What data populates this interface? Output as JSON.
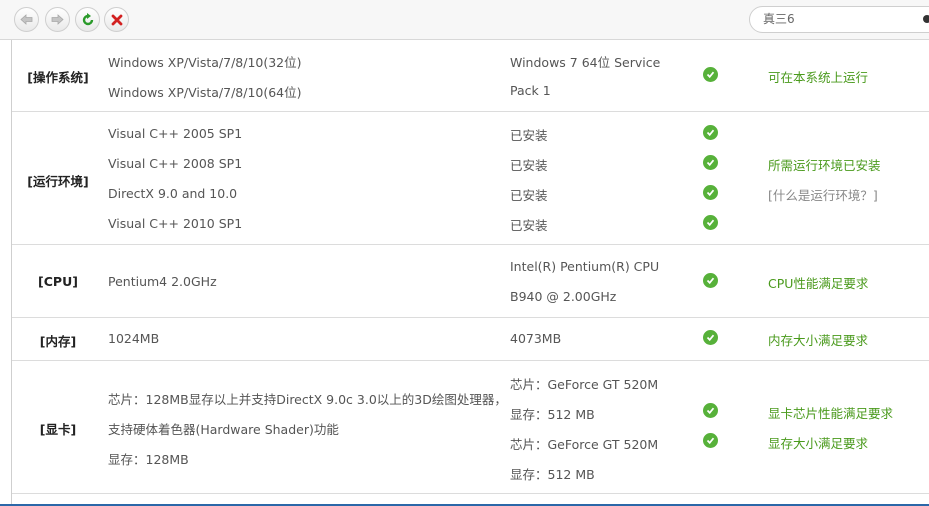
{
  "toolbar": {
    "back_icon": "back-arrow-icon",
    "forward_icon": "forward-arrow-icon",
    "refresh_icon": "refresh-icon",
    "stop_icon": "close-icon",
    "search_value": "真三6"
  },
  "colors": {
    "pass_green": "#57b13a",
    "result_green": "#4a9a1c",
    "stop_red": "#d22020",
    "refresh_green": "#2a9a2a"
  },
  "rows": {
    "os": {
      "label": "[操作系统]",
      "req": [
        "Windows XP/Vista/7/8/10(32位)",
        "Windows XP/Vista/7/8/10(64位)"
      ],
      "current": [
        "Windows 7 64位 Service",
        "Pack 1"
      ],
      "result": "可在本系统上运行"
    },
    "runtime": {
      "label": "[运行环境]",
      "req": [
        "Visual C++ 2005 SP1",
        "Visual C++ 2008 SP1",
        "DirectX 9.0 and 10.0",
        "Visual C++ 2010 SP1"
      ],
      "current": [
        "已安装",
        "已安装",
        "已安装",
        "已安装"
      ],
      "result": "所需运行环境已安装",
      "help": "[什么是运行环境？]"
    },
    "cpu": {
      "label": "[CPU]",
      "req": "Pentium4 2.0GHz",
      "current": [
        "Intel(R) Pentium(R) CPU",
        "B940 @ 2.00GHz"
      ],
      "result": "CPU性能满足要求"
    },
    "memory": {
      "label": "[内存]",
      "req": "1024MB",
      "current": "4073MB",
      "result": "内存大小满足要求"
    },
    "gpu": {
      "label": "[显卡]",
      "req": [
        "芯片：128MB显存以上并支持DirectX 9.0c 3.0以上的3D绘图处理器，",
        "支持硬体着色器(Hardware Shader)功能",
        "显存：128MB"
      ],
      "current": [
        "芯片：GeForce GT 520M",
        "显存：512 MB",
        "芯片：GeForce GT 520M",
        "显存：512 MB"
      ],
      "result": [
        "显卡芯片性能满足要求",
        "显存大小满足要求"
      ]
    }
  }
}
